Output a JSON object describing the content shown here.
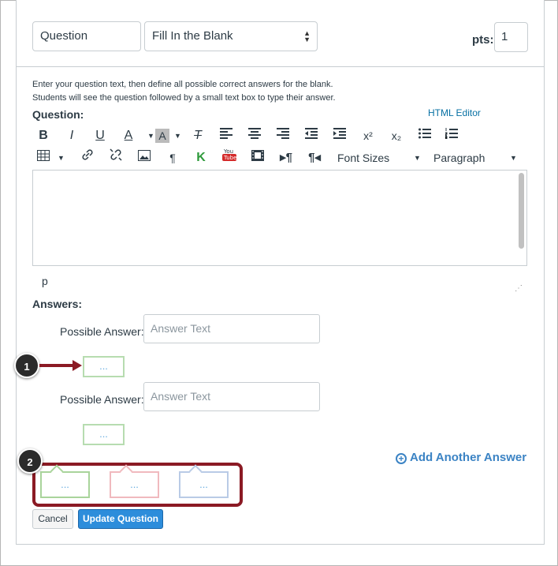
{
  "header": {
    "question_name": "Question",
    "question_type": "Fill In the Blank",
    "pts_label": "pts:",
    "pts_value": "1"
  },
  "instructions": {
    "line1": "Enter your question text, then define all possible correct answers for the blank.",
    "line2": "Students will see the question followed by a small text box to type their answer."
  },
  "question_label": "Question:",
  "html_editor_link": "HTML Editor",
  "toolbar": {
    "row1": [
      "B",
      "I",
      "U",
      "A",
      "A",
      "T",
      "align-left",
      "align-center",
      "align-right",
      "outdent",
      "indent",
      "x²",
      "x₂",
      "bullets",
      "numbers"
    ],
    "font_sizes": "Font Sizes",
    "paragraph": "Paragraph"
  },
  "editor_path": "p",
  "answers_label": "Answers:",
  "answers": [
    {
      "label": "Possible Answer:",
      "placeholder": "Answer Text",
      "dots": "..."
    },
    {
      "label": "Possible Answer:",
      "placeholder": "Answer Text",
      "dots": "..."
    }
  ],
  "add_answer_label": "Add Another Answer",
  "tag_boxes": [
    {
      "dots": "...",
      "color": "#a9d49b"
    },
    {
      "dots": "...",
      "color": "#f0b9be"
    },
    {
      "dots": "...",
      "color": "#b9cbe6"
    }
  ],
  "buttons": {
    "cancel": "Cancel",
    "update": "Update Question"
  },
  "callouts": {
    "one": "1",
    "two": "2"
  },
  "colors": {
    "accent_red": "#8b1a24",
    "primary_blue": "#2d8ddb",
    "link_blue": "#0770a3"
  }
}
